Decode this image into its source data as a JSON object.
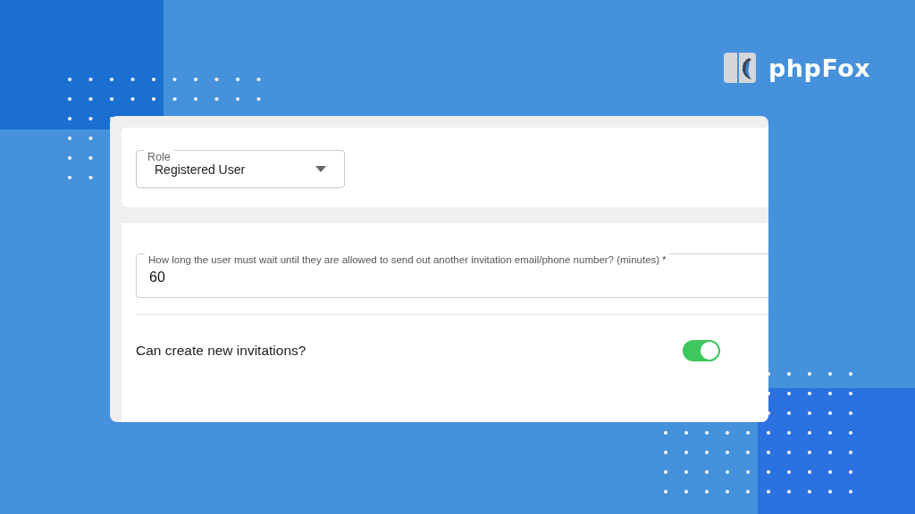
{
  "logo": {
    "text": "phpFox"
  },
  "role_field": {
    "label": "Role",
    "value": "Registered User"
  },
  "wait_field": {
    "label": "How long the user must wait until they are allowed to send out another invitation email/phone number? (minutes)",
    "required": true,
    "required_mark": "*",
    "value": "60"
  },
  "invitation_toggle": {
    "label": "Can create new invitations?",
    "on": true
  }
}
